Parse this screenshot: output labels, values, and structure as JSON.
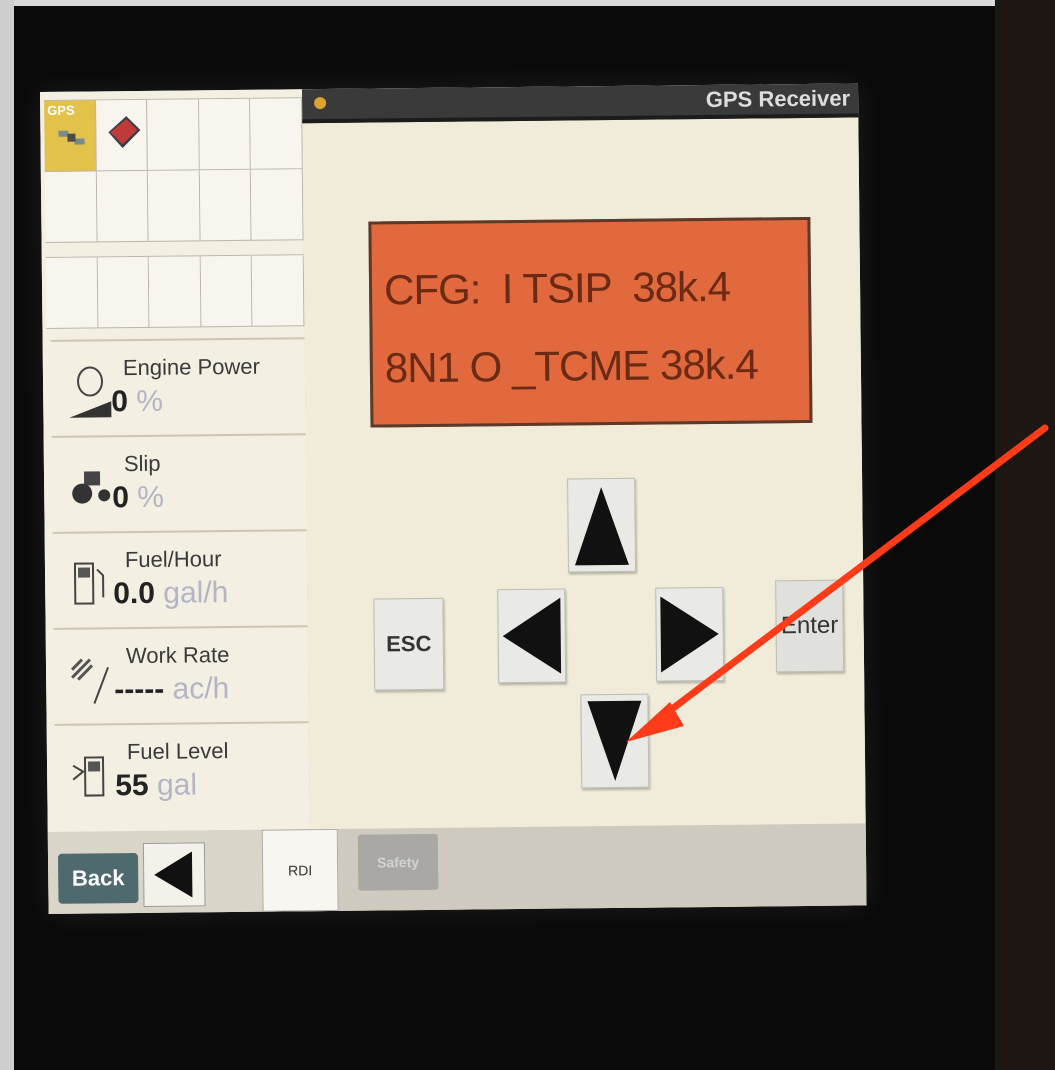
{
  "header": {
    "title": "GPS Receiver"
  },
  "grid": {
    "gps_label": "GPS"
  },
  "metrics": [
    {
      "label": "Engine Power",
      "value": "0",
      "unit": "%",
      "icon": "engine-icon"
    },
    {
      "label": "Slip",
      "value": "0",
      "unit": "%",
      "icon": "tractor-icon"
    },
    {
      "label": "Fuel/Hour",
      "value": "0.0",
      "unit": "gal/h",
      "icon": "fuel-pump-icon"
    },
    {
      "label": "Work Rate",
      "value": "-----",
      "unit": "ac/h",
      "icon": "work-rate-icon"
    },
    {
      "label": "Fuel Level",
      "value": "55",
      "unit": "gal",
      "icon": "fuel-level-icon"
    }
  ],
  "lcd": {
    "line1": "CFG:  I TSIP  38k.4",
    "line2": "8N1 O _TCME 38k.4"
  },
  "buttons": {
    "esc": "ESC",
    "enter": "Enter",
    "back": "Back",
    "rdi": "RDI",
    "safety": "Safety"
  },
  "colors": {
    "lcd": "#e2683d",
    "gps_tile": "#e2c24a",
    "annotation_arrow": "#ff3b1a",
    "back_button": "#4f6a6e"
  }
}
